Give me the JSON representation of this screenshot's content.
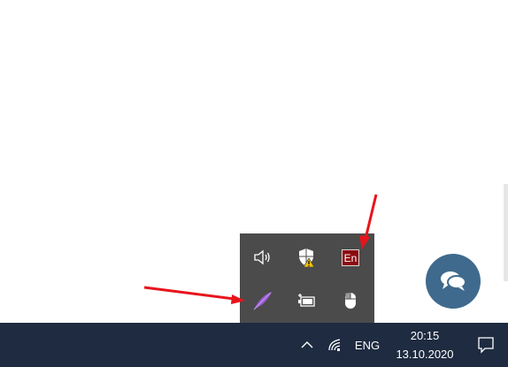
{
  "tray": {
    "icons": [
      {
        "icon": "speaker-icon"
      },
      {
        "icon": "windows-security-warning-icon"
      },
      {
        "icon": "language-indicator-icon",
        "label": "En"
      },
      {
        "icon": "purple-feather-icon"
      },
      {
        "icon": "battery-icon"
      },
      {
        "icon": "mouse-icon"
      }
    ]
  },
  "chat": {
    "icon": "chat-bubbles-icon",
    "color": "#3f6a8d"
  },
  "taskbar": {
    "language": "ENG",
    "time": "20:15",
    "date": "13.10.2020",
    "background": "#1e2b40"
  },
  "annotations": {
    "arrow_color": "#e8141c"
  }
}
